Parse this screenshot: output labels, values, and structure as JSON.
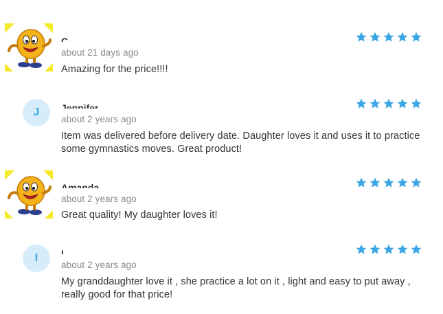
{
  "colors": {
    "star": "#3aa7e4",
    "avatar_bg": "#d6ecfb",
    "avatar_text": "#3aa7e4",
    "time_text": "#8a8a8a",
    "body_text": "#333333"
  },
  "reviews": [
    {
      "avatar": "smiley-cartoon-icon",
      "initial": "",
      "name": "C...",
      "time": "about 21 days ago",
      "rating": 5,
      "text": "Amazing for the price!!!!"
    },
    {
      "avatar": "letter",
      "initial": "J",
      "name": "Jennifer",
      "time": "about 2 years ago",
      "rating": 5,
      "text": "Item was delivered before delivery date. Daughter loves it and uses it to practice some gymnastics moves. Great product!"
    },
    {
      "avatar": "smiley-cartoon-icon",
      "initial": "",
      "name": "Amanda",
      "time": "about 2 years ago",
      "rating": 5,
      "text": "Great quality! My daughter loves it!"
    },
    {
      "avatar": "letter",
      "initial": "I",
      "name": "I...",
      "time": "about 2 years ago",
      "rating": 5,
      "text": "My granddaughter love it , she practice a lot on it , light and easy to put away , really good for that price!"
    }
  ]
}
